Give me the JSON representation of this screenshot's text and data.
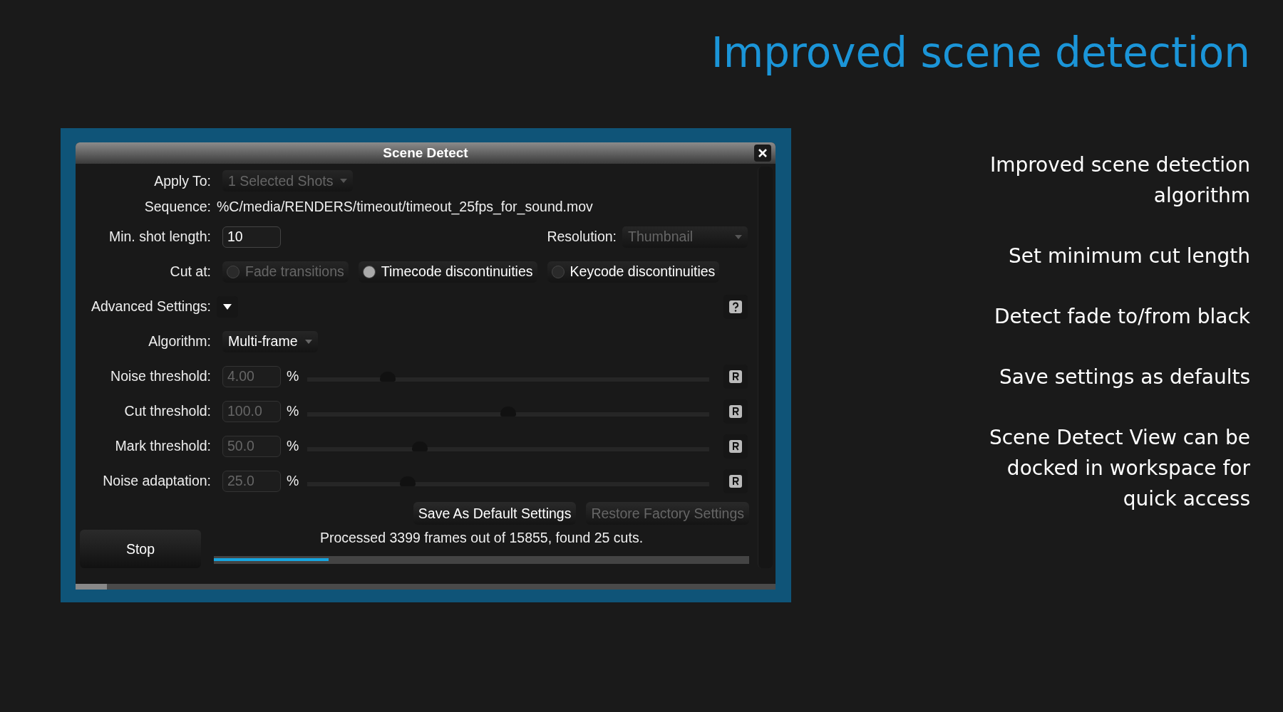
{
  "headline": "Improved scene detection",
  "features": [
    "Improved scene detection algorithm",
    "Set minimum cut length",
    "Detect fade to/from black",
    "Save settings as defaults",
    "Scene Detect View can be docked in workspace for quick access"
  ],
  "dialog": {
    "title": "Scene Detect",
    "apply_to": {
      "label": "Apply To:",
      "value": "1 Selected Shots",
      "disabled": true
    },
    "sequence": {
      "label": "Sequence:",
      "value": "%C/media/RENDERS/timeout/timeout_25fps_for_sound.mov"
    },
    "min_shot_length": {
      "label": "Min. shot length:",
      "value": "10"
    },
    "resolution": {
      "label": "Resolution:",
      "value": "Thumbnail",
      "disabled": true
    },
    "cut_at": {
      "label": "Cut at:",
      "options": [
        {
          "label": "Fade transitions",
          "checked": false,
          "disabled": true
        },
        {
          "label": "Timecode discontinuities",
          "checked": true,
          "disabled": false
        },
        {
          "label": "Keycode discontinuities",
          "checked": false,
          "disabled": false
        }
      ]
    },
    "advanced_settings": {
      "label": "Advanced Settings:",
      "expanded": true
    },
    "algorithm": {
      "label": "Algorithm:",
      "value": "Multi-frame"
    },
    "thresholds": [
      {
        "label": "Noise threshold:",
        "value": "4.00",
        "disabled": true,
        "unit": "%",
        "level": 0.2
      },
      {
        "label": "Cut threshold:",
        "value": "100.0",
        "disabled": true,
        "unit": "%",
        "level": 0.5
      },
      {
        "label": "Mark threshold:",
        "value": "50.0",
        "disabled": true,
        "unit": "%",
        "level": 0.28
      },
      {
        "label": "Noise adaptation:",
        "value": "25.0",
        "disabled": true,
        "unit": "%",
        "level": 0.25
      }
    ],
    "buttons": [
      {
        "label": "Save As Default Settings",
        "disabled": false
      },
      {
        "label": "Restore Factory Settings",
        "disabled": true
      }
    ],
    "stop_button": "Stop",
    "status": "Processed 3399 frames out of 15855, found 25 cuts.",
    "progress": {
      "level": 0.214
    }
  }
}
